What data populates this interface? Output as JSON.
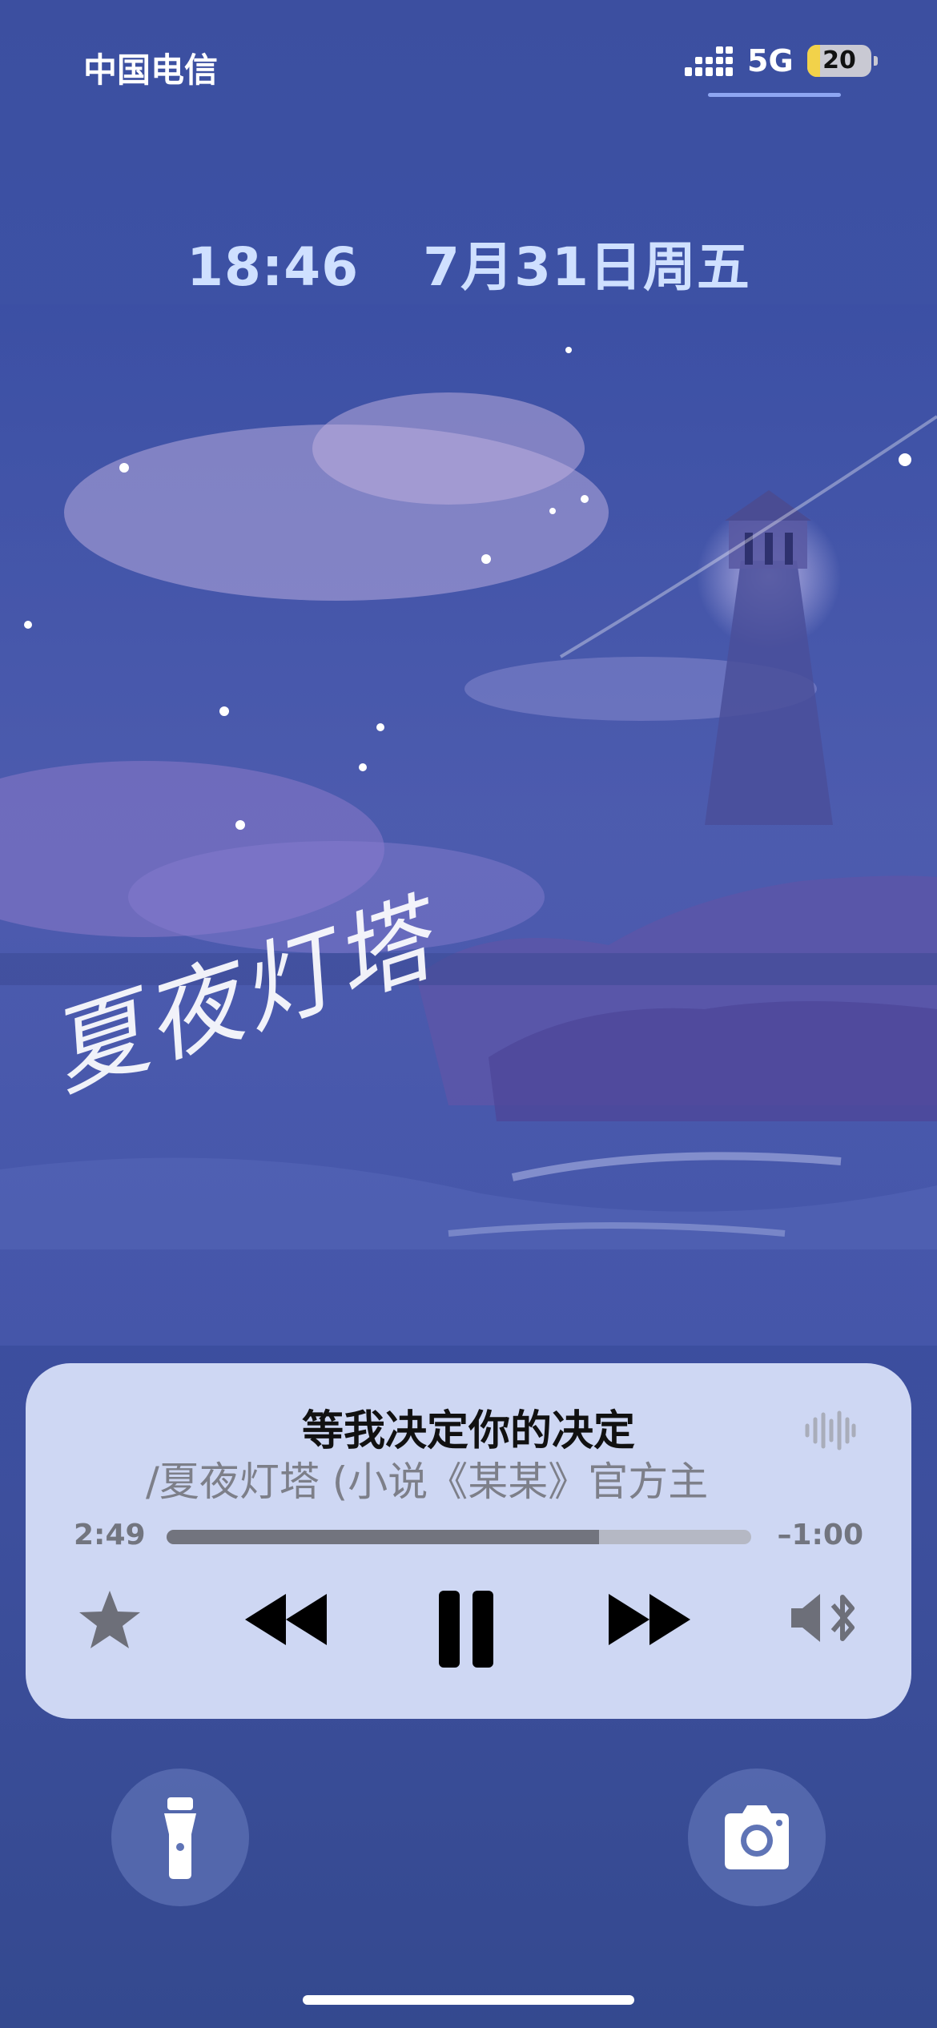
{
  "status_bar": {
    "carrier": "中国电信",
    "network": "5G",
    "battery": "20"
  },
  "lock_screen": {
    "time": "18:46",
    "date": "7月31日周五"
  },
  "artwork": {
    "calligraphy": "夏夜灯塔"
  },
  "now_playing": {
    "title": "等我决定你的决定",
    "subtitle": "/夏夜灯塔 (小说《某某》官方主",
    "elapsed": "2:49",
    "remaining": "–1:00",
    "progress": 0.74
  },
  "icons": {
    "favorite": "star-icon",
    "previous": "rewind-icon",
    "play_pause": "pause-icon",
    "next": "fast-forward-icon",
    "output": "speaker-bluetooth-icon",
    "visualizer": "waveform-icon",
    "flashlight": "flashlight-icon",
    "camera": "camera-icon"
  },
  "colors": {
    "background": "#3d50a2",
    "player_card": "#d6def8",
    "progress_fill": "#72747e",
    "date_text": "#cfe0ff"
  }
}
